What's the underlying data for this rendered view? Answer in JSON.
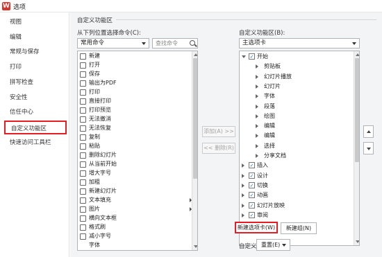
{
  "window": {
    "logo_glyph": "W",
    "title": "选项"
  },
  "sidebar": {
    "items": [
      {
        "label": "视图",
        "name": "sidebar-item-view"
      },
      {
        "label": "编辑",
        "name": "sidebar-item-edit"
      },
      {
        "label": "常规与保存",
        "name": "sidebar-item-general-save"
      },
      {
        "label": "打印",
        "name": "sidebar-item-print"
      },
      {
        "label": "拼写检查",
        "name": "sidebar-item-spellcheck"
      },
      {
        "label": "安全性",
        "name": "sidebar-item-security"
      },
      {
        "label": "信任中心",
        "name": "sidebar-item-trust-center"
      },
      {
        "label": "自定义功能区",
        "name": "sidebar-item-customize-ribbon",
        "active": true
      },
      {
        "label": "快速访问工具栏",
        "name": "sidebar-item-quick-access"
      }
    ],
    "highlight_color": "#e51c23"
  },
  "section": {
    "title": "自定义功能区"
  },
  "left": {
    "label": "从下列位置选择命令(C):",
    "select_value": "常用命令",
    "search_placeholder": "查找命令",
    "commands": [
      {
        "label": "新建",
        "icon": "new-doc-icon"
      },
      {
        "label": "打开",
        "icon": "open-folder-icon"
      },
      {
        "label": "保存",
        "icon": "save-icon"
      },
      {
        "label": "输出为PDF",
        "icon": "pdf-icon"
      },
      {
        "label": "打印",
        "icon": "print-icon"
      },
      {
        "label": "直接打印",
        "icon": "direct-print-icon"
      },
      {
        "label": "打印预览",
        "icon": "print-preview-icon"
      },
      {
        "label": "无法撤消",
        "icon": "undo-icon"
      },
      {
        "label": "无法恢复",
        "icon": "redo-icon"
      },
      {
        "label": "复制",
        "icon": "copy-icon"
      },
      {
        "label": "粘贴",
        "icon": "paste-icon"
      },
      {
        "label": "删除幻灯片",
        "icon": "delete-slide-icon"
      },
      {
        "label": "从当前开始",
        "icon": "play-current-icon"
      },
      {
        "label": "增大字号",
        "icon": "font-increase-icon"
      },
      {
        "label": "加粗",
        "icon": "bold-icon"
      },
      {
        "label": "新建幻灯片",
        "icon": "new-slide-icon"
      },
      {
        "label": "文本填充",
        "icon": "text-fill-icon",
        "submenu": true
      },
      {
        "label": "图片",
        "icon": "picture-icon",
        "submenu": true
      },
      {
        "label": "横向文本框",
        "icon": "textbox-icon"
      },
      {
        "label": "格式刷",
        "icon": "format-painter-icon"
      },
      {
        "label": "减小字号",
        "icon": "font-decrease-icon"
      },
      {
        "label": "字体",
        "icon": ""
      }
    ]
  },
  "middle": {
    "add_label": "添加(A) >>",
    "remove_label": "<< 删除(R)"
  },
  "right": {
    "label": "自定义功能区(B):",
    "select_value": "主选项卡",
    "tree": [
      {
        "label": "开始",
        "level": 0,
        "expanded": true,
        "checked": true
      },
      {
        "label": "剪贴板",
        "level": 1
      },
      {
        "label": "幻灯片播放",
        "level": 1
      },
      {
        "label": "幻灯片",
        "level": 1
      },
      {
        "label": "字体",
        "level": 1
      },
      {
        "label": "段落",
        "level": 1
      },
      {
        "label": "绘图",
        "level": 1
      },
      {
        "label": "编辑",
        "level": 1
      },
      {
        "label": "编辑",
        "level": 1
      },
      {
        "label": "选择",
        "level": 1
      },
      {
        "label": "分享文档",
        "level": 1
      },
      {
        "label": "插入",
        "level": 0,
        "expanded": false,
        "checked": true
      },
      {
        "label": "设计",
        "level": 0,
        "expanded": false,
        "checked": true
      },
      {
        "label": "切换",
        "level": 0,
        "expanded": false,
        "checked": true
      },
      {
        "label": "动画",
        "level": 0,
        "expanded": false,
        "checked": true
      },
      {
        "label": "幻灯片放映",
        "level": 0,
        "expanded": false,
        "checked": true
      },
      {
        "label": "审阅",
        "level": 0,
        "expanded": false,
        "checked": true
      }
    ],
    "new_tab_label": "新建选项卡(W)",
    "new_group_label": "新建组(N)",
    "customize_label": "自定义:",
    "reset_label": "重置(E)"
  }
}
